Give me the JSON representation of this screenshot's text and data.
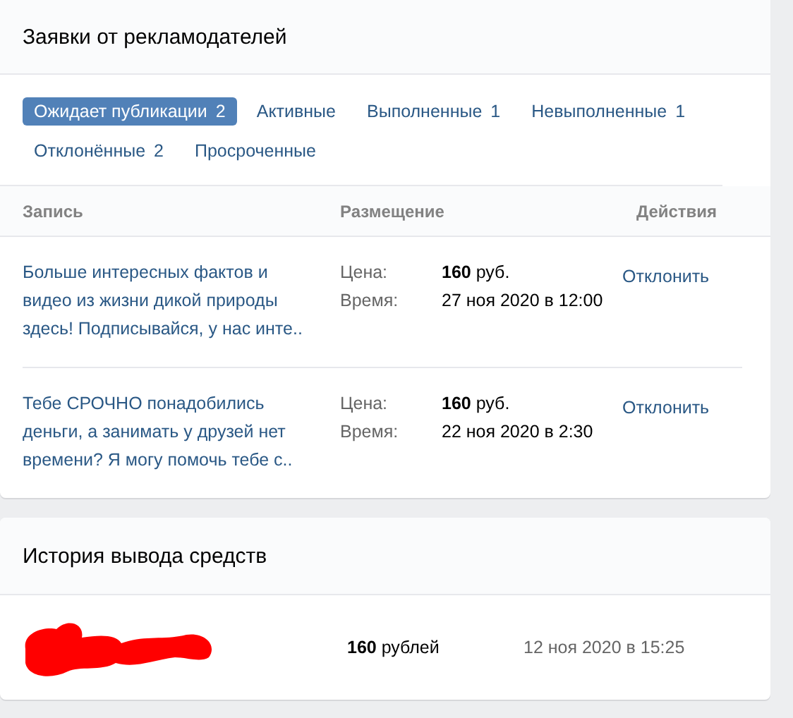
{
  "requests_card": {
    "title": "Заявки от рекламодателей",
    "tabs": [
      {
        "label": "Ожидает публикации",
        "count": "2",
        "selected": true
      },
      {
        "label": "Активные",
        "selected": false
      },
      {
        "label": "Выполненные",
        "count": "1",
        "selected": false
      },
      {
        "label": "Невыполненные",
        "count": "1",
        "selected": false
      },
      {
        "label": "Отклонённые",
        "count": "2",
        "selected": false
      },
      {
        "label": "Просроченные",
        "selected": false
      }
    ],
    "columns": [
      "Запись",
      "Размещение",
      "Действия"
    ],
    "rows": [
      {
        "text": "Больше интересных фактов и видео из жизни дикой природы здесь! Подписывайся, у нас инте..",
        "price_label": "Цена:",
        "price": "**160** руб.",
        "time_label": "Время:",
        "time": "27 ноя 2020 в 12:00",
        "action": "Отклонить"
      },
      {
        "text": "Тебе СРОЧНО понадобились деньги, а занимать у друзей нет времени? Я могу помочь тебе с..",
        "price_label": "Цена:",
        "price": "**160** руб.",
        "time_label": "Время:",
        "time": "22 ноя 2020 в 2:30",
        "action": "Отклонить"
      }
    ]
  },
  "history_card": {
    "title": "История вывода средств",
    "rows": [
      {
        "amount": "**160** рублей",
        "date": "12 ноя 2020 в 15:25"
      }
    ]
  }
}
